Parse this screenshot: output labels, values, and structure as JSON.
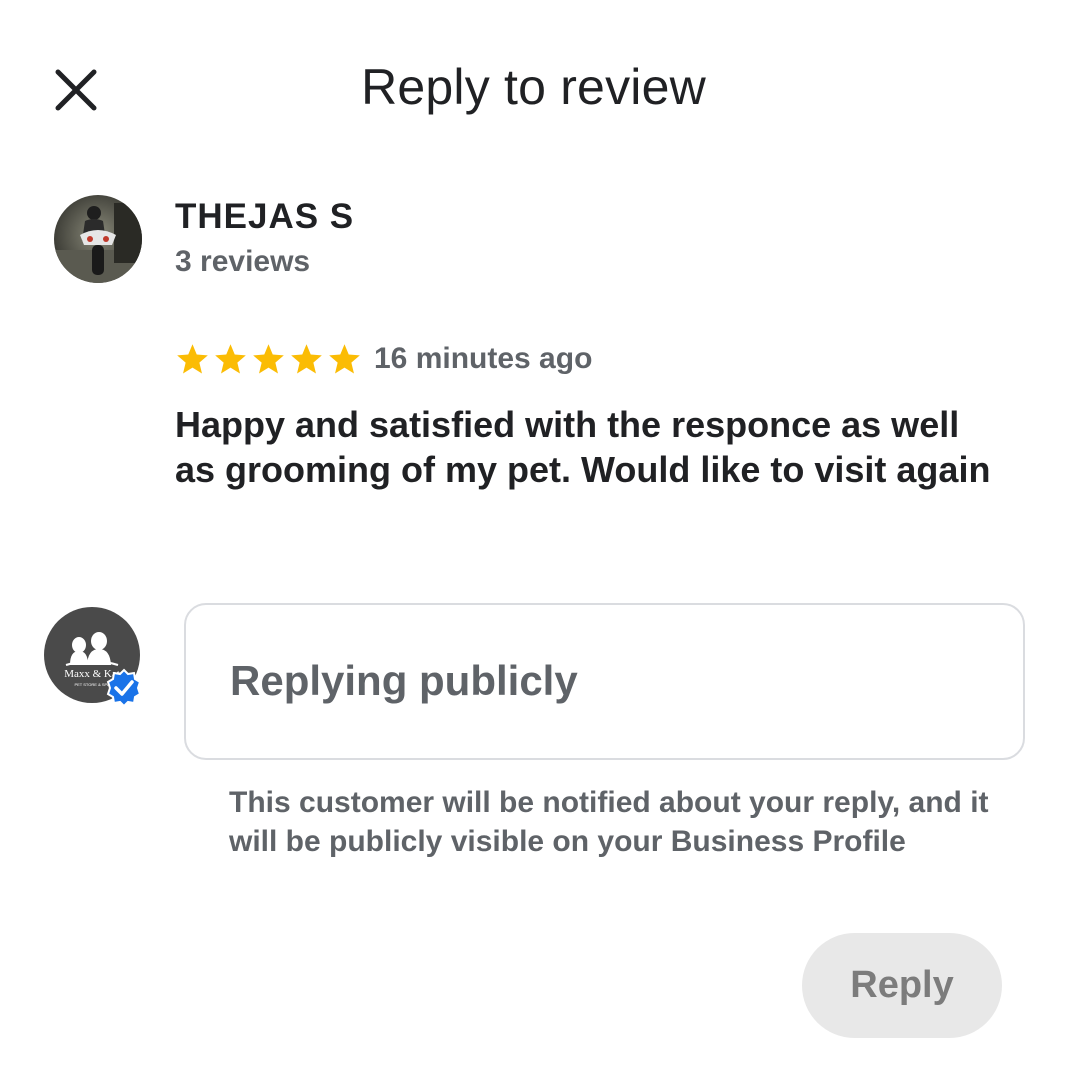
{
  "header": {
    "title": "Reply to review",
    "close_icon": "close-icon"
  },
  "review": {
    "reviewer_name": "THEJAS S",
    "reviewer_count": "3 reviews",
    "rating": 5,
    "star_color": "#fbbc04",
    "time": "16 minutes ago",
    "text": "Happy and satisfied with the responce as well as grooming of my pet. Would like to visit again"
  },
  "business": {
    "logo_text": "Maxx & Kat",
    "logo_subtext": "PET STORE & SPA",
    "verified_color": "#1a73e8"
  },
  "reply": {
    "placeholder": "Replying publicly",
    "value": "",
    "notice": "This customer will be notified about your reply, and it will be publicly visible on your Business Profile",
    "button_label": "Reply"
  }
}
